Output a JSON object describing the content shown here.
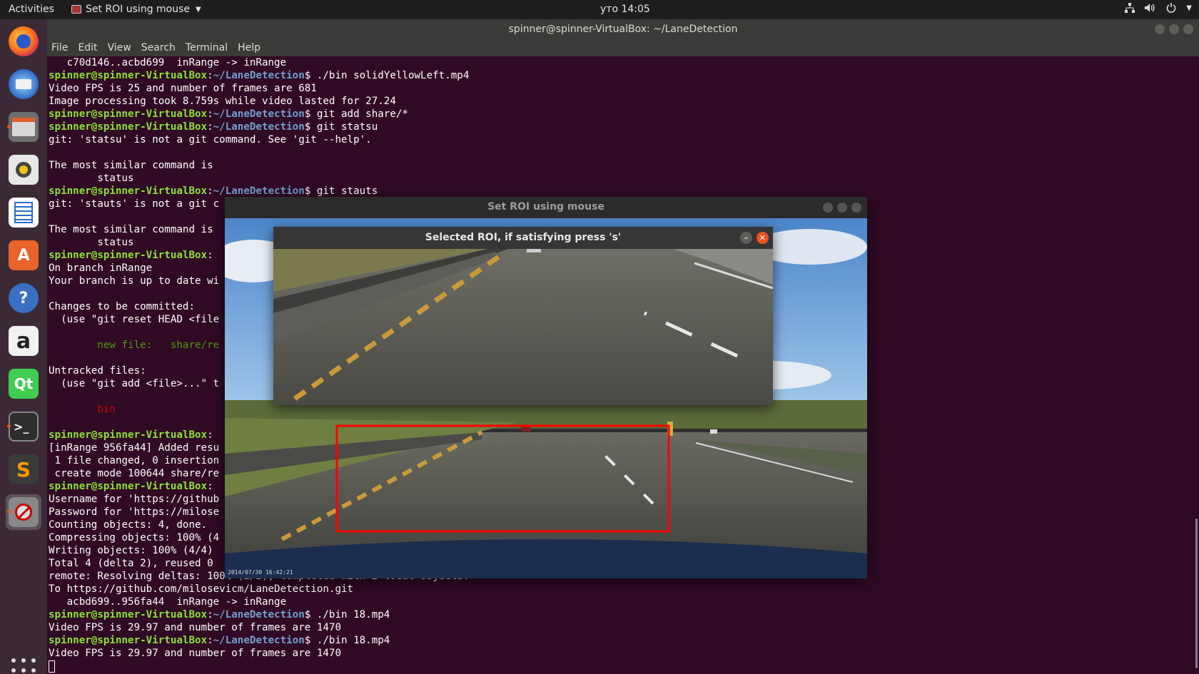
{
  "topbar": {
    "activities": "Activities",
    "app_menu": "Set ROI using mouse",
    "clock": "уто 14:05"
  },
  "dock": {
    "items": [
      {
        "name": "firefox-icon",
        "glyph": ""
      },
      {
        "name": "thunderbird-icon",
        "glyph": ""
      },
      {
        "name": "files-icon",
        "glyph": ""
      },
      {
        "name": "rhythmbox-icon",
        "glyph": ""
      },
      {
        "name": "writer-icon",
        "glyph": ""
      },
      {
        "name": "software-center-icon",
        "glyph": "A"
      },
      {
        "name": "help-icon",
        "glyph": "?"
      },
      {
        "name": "amazon-icon",
        "glyph": "a"
      },
      {
        "name": "qt-creator-icon",
        "glyph": "Qt"
      },
      {
        "name": "terminal-icon",
        "glyph": ">_"
      },
      {
        "name": "sublime-text-icon",
        "glyph": "S"
      },
      {
        "name": "opencv-window-icon",
        "glyph": ""
      }
    ]
  },
  "terminal": {
    "title": "spinner@spinner-VirtualBox: ~/LaneDetection",
    "menu": [
      "File",
      "Edit",
      "View",
      "Search",
      "Terminal",
      "Help"
    ],
    "user": "spinner@spinner-VirtualBox",
    "path": "~/LaneDetection",
    "lines": {
      "l1": "   c70d146..acbd699  inRange -> inRange",
      "l2_cmd": "$ ./bin solidYellowLeft.mp4",
      "l3": "Video FPS is 25 and number of frames are 681",
      "l4": "Image processing took 8.759s while video lasted for 27.24",
      "l5_cmd": "$ git add share/*",
      "l6_cmd": "$ git statsu",
      "l7": "git: 'statsu' is not a git command. See 'git --help'.",
      "l9": "The most similar command is",
      "l10": "        status",
      "l11_cmd": "$ git stauts",
      "l12": "git: 'stauts' is not a git c",
      "l14": "The most similar command is",
      "l15": "        status",
      "l17": "On branch inRange",
      "l18": "Your branch is up to date wi",
      "l20": "Changes to be committed:",
      "l21": "  (use \"git reset HEAD <file",
      "l23": "        new file:   share/re",
      "l25": "Untracked files:",
      "l26": "  (use \"git add <file>...\" t",
      "l28": "        bin",
      "l30": "[inRange 956fa44] Added resu",
      "l31": " 1 file changed, 0 insertion",
      "l32": " create mode 100644 share/re",
      "l34": "Username for 'https://github",
      "l35": "Password for 'https://milose",
      "l36": "Counting objects: 4, done.",
      "l37": "Compressing objects: 100% (4",
      "l38": "Writing objects: 100% (4/4)",
      "l39": "Total 4 (delta 2), reused 0",
      "l40": "remote: Resolving deltas: 100% (2/2), completed with 2 local objects.",
      "l41": "To https://github.com/milosevicm/LaneDetection.git",
      "l42": "   acbd699..956fa44  inRange -> inRange",
      "l43_cmd": "$ ./bin 18.mp4",
      "l44": "Video FPS is 29.97 and number of frames are 1470",
      "l45_cmd": "$ ./bin 18.mp4",
      "l46": "Video FPS is 29.97 and number of frames are 1470"
    }
  },
  "roi_window": {
    "title": "Set ROI using mouse",
    "timestamp": "2014/07/30 16:42:21"
  },
  "selected_window": {
    "title": "Selected ROI, if satisfying press 's'"
  },
  "colors": {
    "terminal_bg": "#300a24",
    "user_green": "#8ae234",
    "path_blue": "#729fcf",
    "roi_rect": "#ff0000",
    "close_orange": "#e95420"
  }
}
